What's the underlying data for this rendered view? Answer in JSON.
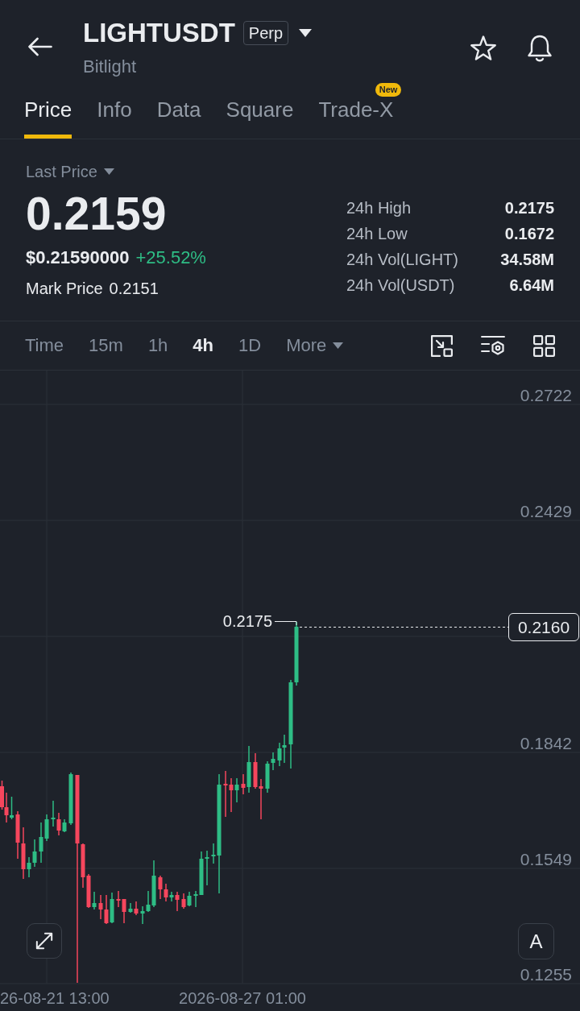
{
  "header": {
    "title": "LIGHTUSDT",
    "badge": "Perp",
    "subtitle": "Bitlight"
  },
  "tabs": [
    {
      "label": "Price",
      "selected": true
    },
    {
      "label": "Info",
      "selected": false
    },
    {
      "label": "Data",
      "selected": false
    },
    {
      "label": "Square",
      "selected": false
    },
    {
      "label": "Trade-X",
      "selected": false,
      "badge": "New"
    }
  ],
  "price": {
    "selector": "Last Price",
    "last_price": "0.2159",
    "usd_price": "$0.21590000",
    "change": "+25.52%",
    "mark_price_label": "Mark Price",
    "mark_price": "0.2151"
  },
  "stats": [
    {
      "label": "24h High",
      "value": "0.2175"
    },
    {
      "label": "24h Low",
      "value": "0.1672"
    },
    {
      "label": "24h Vol(LIGHT)",
      "value": "34.58M"
    },
    {
      "label": "24h Vol(USDT)",
      "value": "6.64M"
    }
  ],
  "intervals": [
    {
      "label": "Time",
      "selected": false
    },
    {
      "label": "15m",
      "selected": false
    },
    {
      "label": "1h",
      "selected": false
    },
    {
      "label": "4h",
      "selected": true
    },
    {
      "label": "1D",
      "selected": false
    }
  ],
  "more": "More",
  "chart": {
    "price_axis": [
      "0.2722",
      "0.2429",
      "0.1842",
      "0.1549",
      "0.1255"
    ],
    "last_price_tag": "0.2160",
    "high_marker": "0.2175",
    "time_axis": [
      "26-08-21 13:00",
      "2026-08-27 01:00"
    ],
    "scale_button": "A"
  }
}
